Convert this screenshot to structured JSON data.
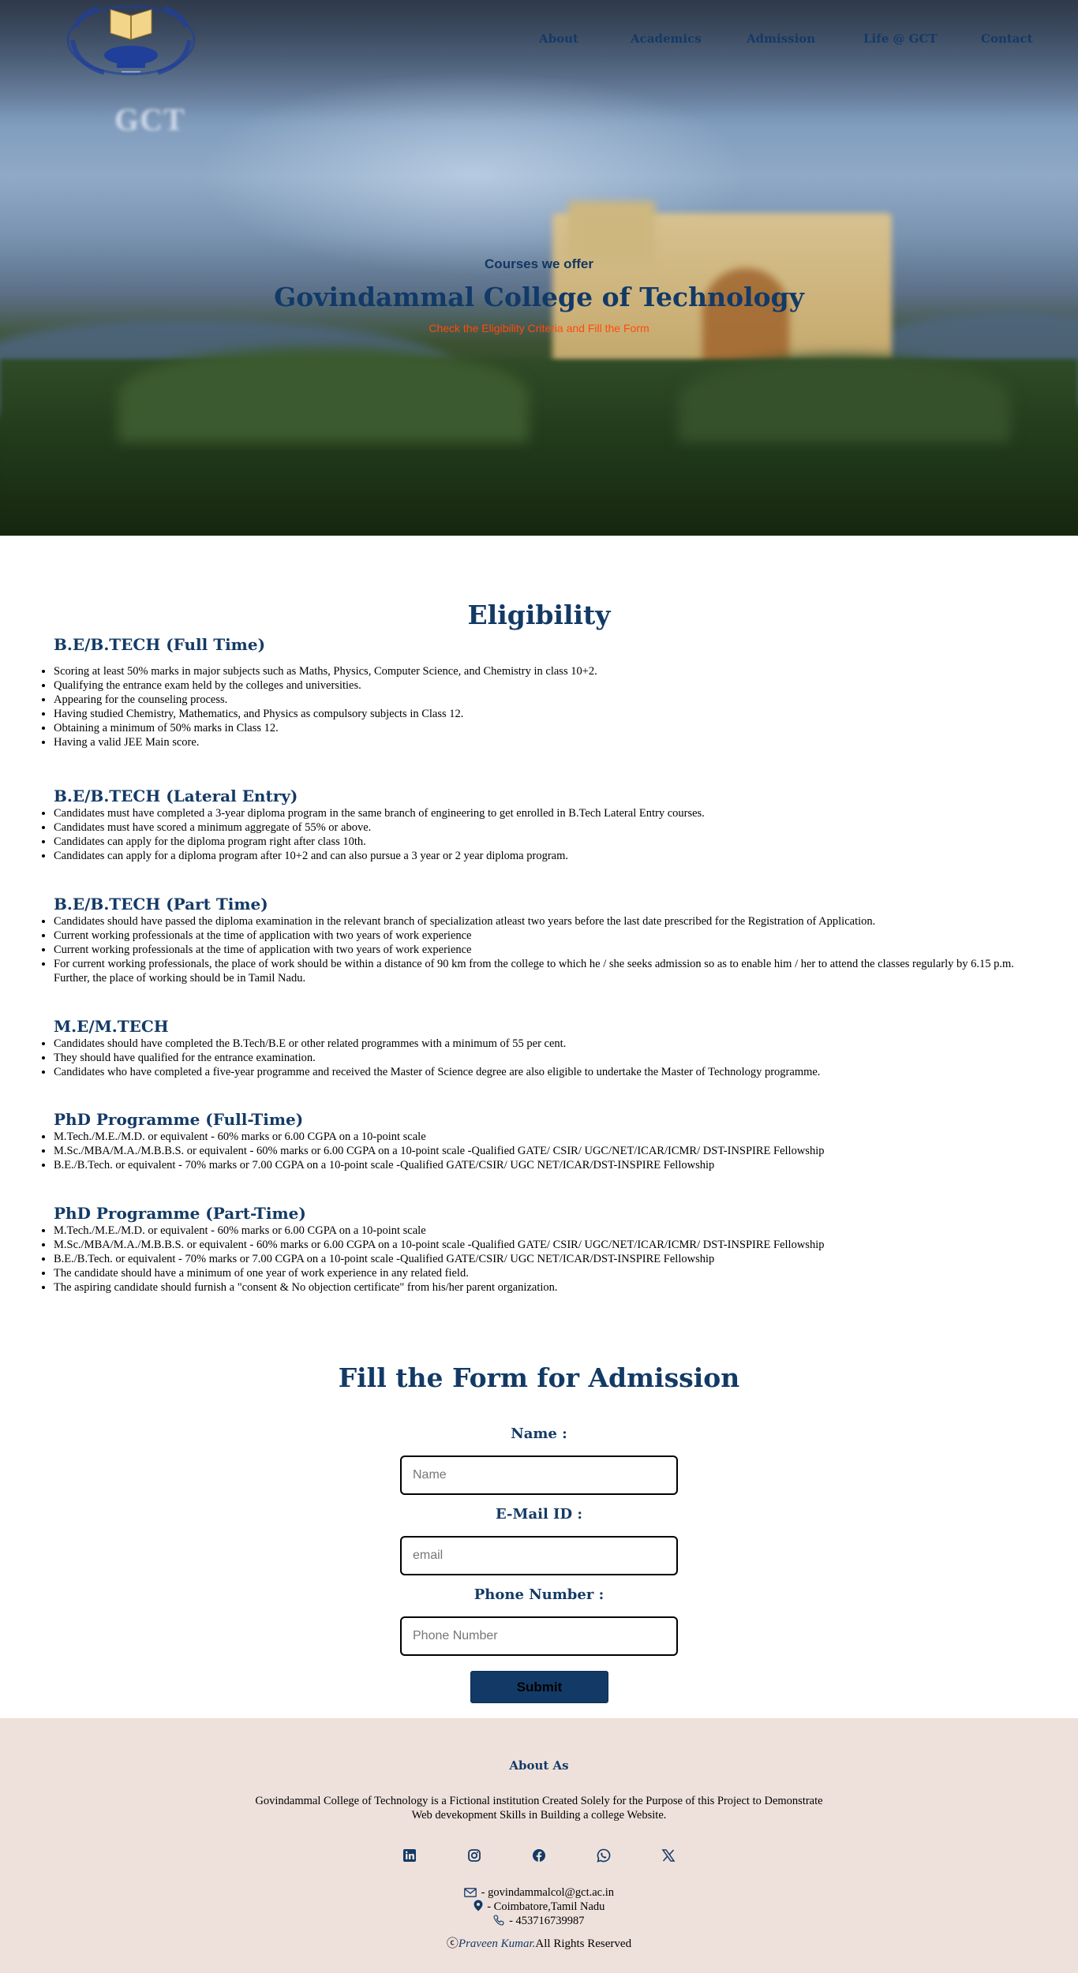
{
  "nav": {
    "items": [
      "About",
      "Academics",
      "Admission",
      "Life @ GCT",
      "Contact"
    ]
  },
  "logo": {
    "icon": "book-emblem-icon",
    "subtext": "GCT"
  },
  "hero": {
    "kicker": "Courses we offer",
    "title": "Govindammal College of Technology",
    "subtitle": "Check the Eligibility Criteria and Fill the Form"
  },
  "eligibility": {
    "title": "Eligibility",
    "sections": [
      {
        "heading": "B.E/B.TECH (Full Time)",
        "items": [
          "Scoring at least 50% marks in major subjects such as Maths, Physics, Computer Science, and Chemistry in class 10+2.",
          "Qualifying the entrance exam held by the colleges and universities.",
          "Appearing for the counseling process.",
          "Having studied Chemistry, Mathematics, and Physics as compulsory subjects in Class 12.",
          "Obtaining a minimum of 50% marks in Class 12.",
          "Having a valid JEE Main score."
        ]
      },
      {
        "heading": "B.E/B.TECH (Lateral Entry)",
        "items": [
          "Candidates must have completed a 3-year diploma program in the same branch of engineering to get enrolled in B.Tech Lateral Entry courses.",
          "Candidates must have scored a minimum aggregate of 55% or above.",
          "Candidates can apply for the diploma program right after class 10th.",
          "Candidates can apply for a diploma program after 10+2 and can also pursue a 3 year or 2 year diploma program."
        ]
      },
      {
        "heading": "B.E/B.TECH (Part Time)",
        "items": [
          "Candidates should have passed the diploma examination in the relevant branch of specialization atleast two years before the last date prescribed for the Registration of Application.",
          "Current working professionals at the time of application with two years of work experience",
          "Current working professionals at the time of application with two years of work experience",
          "For current working professionals, the place of work should be within a distance of 90 km from the college to which he / she seeks admission so as to enable him / her to attend the classes regularly by 6.15 p.m. Further, the place of working should be in Tamil Nadu."
        ]
      },
      {
        "heading": "M.E/M.TECH",
        "items": [
          "Candidates should have completed the B.Tech/B.E or other related programmes with a minimum of 55 per cent.",
          "They should have qualified for the entrance examination.",
          "Candidates who have completed a five-year programme and received the Master of Science degree are also eligible to undertake the Master of Technology programme."
        ]
      },
      {
        "heading": "PhD Programme (Full-Time)",
        "items": [
          "M.Tech./M.E./M.D. or equivalent - 60% marks or 6.00 CGPA on a 10-point scale",
          "M.Sc./MBA/M.A./M.B.B.S. or equivalent - 60% marks or 6.00 CGPA on a 10-point scale -Qualified GATE/ CSIR/ UGC/NET/ICAR/ICMR/ DST-INSPIRE Fellowship",
          "B.E./B.Tech. or equivalent - 70% marks or 7.00 CGPA on a 10-point scale -Qualified GATE/CSIR/ UGC NET/ICAR/DST-INSPIRE Fellowship"
        ]
      },
      {
        "heading": "PhD Programme (Part-Time)",
        "items": [
          "M.Tech./M.E./M.D. or equivalent - 60% marks or 6.00 CGPA on a 10-point scale",
          "M.Sc./MBA/M.A./M.B.B.S. or equivalent - 60% marks or 6.00 CGPA on a 10-point scale -Qualified GATE/ CSIR/ UGC/NET/ICAR/ICMR/ DST-INSPIRE Fellowship",
          "B.E./B.Tech. or equivalent - 70% marks or 7.00 CGPA on a 10-point scale -Qualified GATE/CSIR/ UGC NET/ICAR/DST-INSPIRE Fellowship",
          "The candidate should have a minimum of one year of work experience in any related field.",
          "The aspiring candidate should furnish a \"consent & No objection certificate\" from his/her parent organization."
        ]
      }
    ]
  },
  "form": {
    "title": "Fill the Form for Admission",
    "name_label": "Name :",
    "name_placeholder": "Name",
    "name_value": "",
    "email_label": "E-Mail ID :",
    "email_placeholder": "email",
    "email_value": "",
    "phone_label": "Phone Number :",
    "phone_placeholder": "Phone Number",
    "phone_value": "",
    "submit_label": "Submit"
  },
  "footer": {
    "title": "About As",
    "text": "Govindammal College of Technology is a Fictional institution Created Solely for the Purpose of this Project to Demonstrate Web devekopment Skills in Building a college Website.",
    "social_icons": [
      "linkedin-icon",
      "instagram-icon",
      "facebook-icon",
      "whatsapp-icon",
      "x-twitter-icon"
    ],
    "email": " - govindammalcol@gct.ac.in",
    "location": " - Coimbatore,Tamil Nadu",
    "phone": " - 453716739987",
    "copyright_symbol": "ⓒ",
    "author": "Praveen Kumar.",
    "rights": "All Rights Reserved"
  },
  "colors": {
    "primary": "#133a66",
    "accent": "#ff4a0f",
    "footer_bg": "#eee1dc"
  }
}
